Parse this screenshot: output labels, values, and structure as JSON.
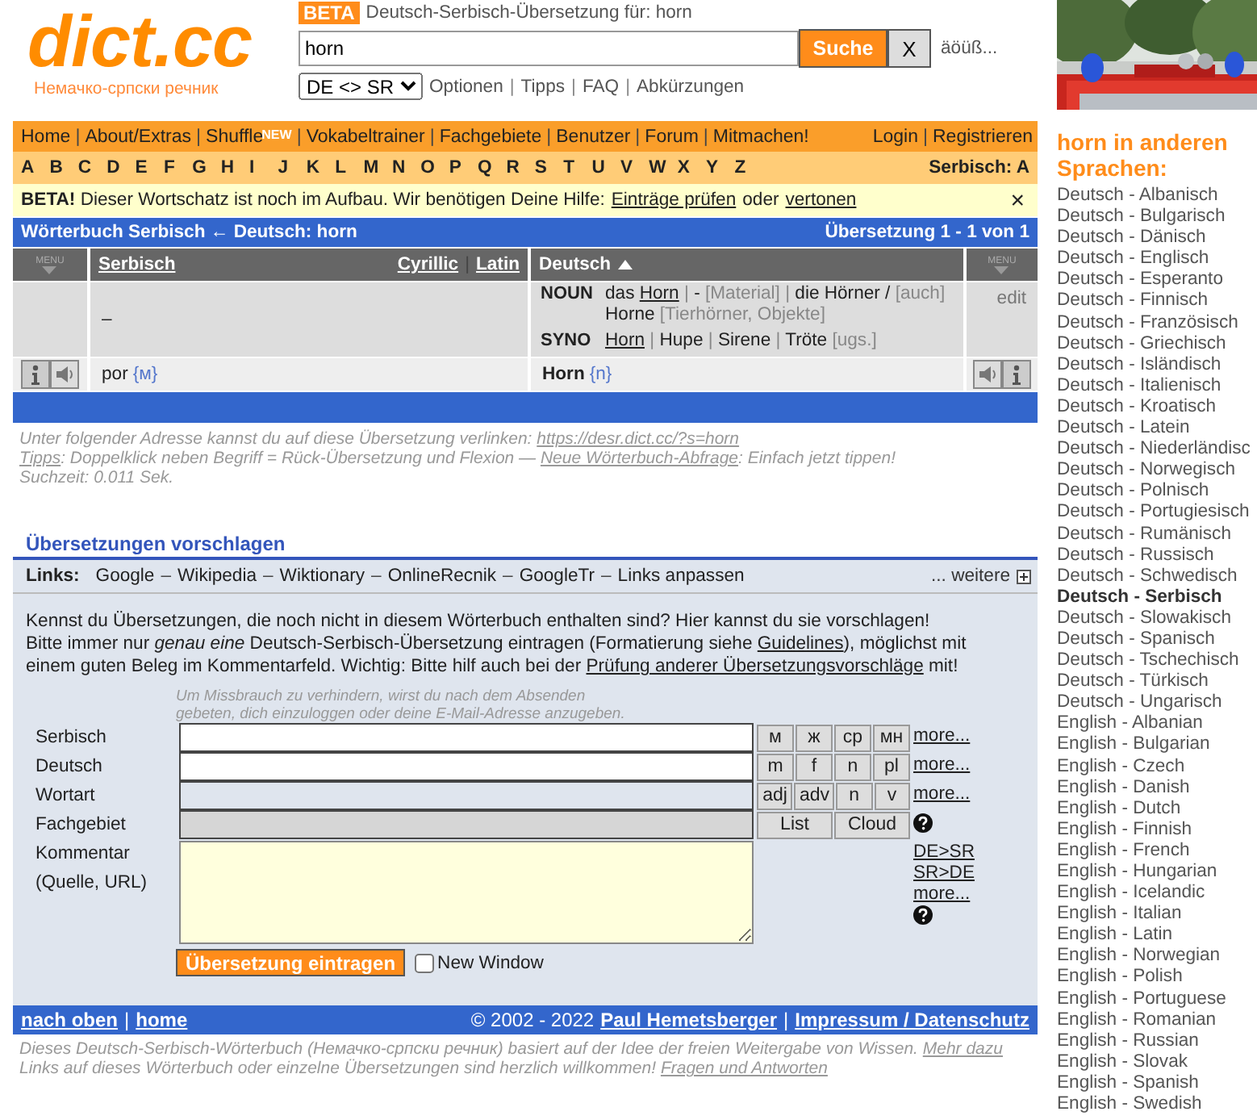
{
  "header": {
    "logo": "dict.cc",
    "subtitle": "Немачко-српски речник",
    "badge": "BETA",
    "heading": "Deutsch-Serbisch-Übersetzung für: horn",
    "query": "horn",
    "search_button": "Suche",
    "clear_button": "X",
    "special_chars": "äöüß...",
    "direction": "DE <> SR",
    "separator": "|",
    "links": [
      "Optionen",
      "Tipps",
      "FAQ",
      "Abkürzungen"
    ]
  },
  "nav": {
    "separator": "|",
    "items": [
      {
        "label": "Home"
      },
      {
        "label": "About/Extras"
      },
      {
        "label": "Shuffle",
        "badge": "NEW"
      },
      {
        "label": "Vokabeltrainer"
      },
      {
        "label": "Fachgebiete"
      },
      {
        "label": "Benutzer"
      },
      {
        "label": "Forum"
      },
      {
        "label": "Mitmachen!"
      }
    ],
    "right": [
      "Login",
      "Registrieren"
    ]
  },
  "letters": {
    "items": [
      "A",
      "B",
      "C",
      "D",
      "E",
      "F",
      "G",
      "H",
      "I",
      "J",
      "K",
      "L",
      "M",
      "N",
      "O",
      "P",
      "Q",
      "R",
      "S",
      "T",
      "U",
      "V",
      "W",
      "X",
      "Y",
      "Z"
    ],
    "current": "Serbisch: A"
  },
  "notice": {
    "text": "**BETA!** Dieser Wortschatz ist noch im Aufbau. Wir benötigen Deine Hilfe:",
    "link": "Einträge prüfen",
    "joiner": "oder",
    "link2": "vertonen",
    "close": "×"
  },
  "results": {
    "title": "Wörterbuch Serbisch ← Deutsch: horn",
    "count": "Übersetzung 1 - 1 von 1",
    "menu_labels": [
      "MENU",
      "MENU"
    ],
    "left_column": {
      "label": "Serbisch",
      "scripts": [
        "Cyrillic",
        "Latin"
      ],
      "separator": "|"
    },
    "right_column": {
      "label": "Deutsch",
      "sorted": true
    },
    "definition": {
      "left": "–",
      "action": "edit",
      "lines": [
        {
          "tag": "NOUN",
          "segments": [
            {
              "kind": "text",
              "text": "das "
            },
            {
              "kind": "link",
              "text": "Horn"
            },
            {
              "kind": "note",
              "text": " | "
            },
            {
              "kind": "text",
              "text": "- "
            },
            {
              "kind": "note",
              "text": "[Material] | "
            },
            {
              "kind": "text",
              "text": "die Hörner / "
            },
            {
              "kind": "note",
              "text": "[auch] "
            },
            {
              "kind": "text",
              "text": "Horne "
            },
            {
              "kind": "note",
              "text": "[Tierhörner, Objekte]"
            }
          ]
        },
        {
          "tag": "SYNO",
          "segments": [
            {
              "kind": "link",
              "text": "Horn"
            },
            {
              "kind": "note",
              "text": " | "
            },
            {
              "kind": "text",
              "text": "Hupe"
            },
            {
              "kind": "note",
              "text": " | "
            },
            {
              "kind": "text",
              "text": "Sirene"
            },
            {
              "kind": "note",
              "text": " | "
            },
            {
              "kind": "text",
              "text": "Tröte "
            },
            {
              "kind": "note",
              "text": "[ugs.]"
            }
          ]
        }
      ]
    },
    "entry": {
      "left": {
        "term": "por",
        "gender": "{м}"
      },
      "right": {
        "term": "Horn",
        "gender": "{n}"
      }
    }
  },
  "notes": [
    [
      {
        "kind": "text",
        "text": "Unter folgender Adresse kannst du auf diese Übersetzung verlinken: "
      },
      {
        "kind": "link",
        "text": "https://desr.dict.cc/?s=horn"
      }
    ],
    [
      {
        "kind": "link",
        "text": "Tipps"
      },
      {
        "kind": "text",
        "text": ": Doppelklick neben Begriff = Rück-Übersetzung und Flexion — "
      },
      {
        "kind": "link",
        "text": "Neue Wörterbuch-Abfrage"
      },
      {
        "kind": "text",
        "text": ": Einfach jetzt tippen!"
      }
    ],
    [
      {
        "kind": "text",
        "text": "Suchzeit: 0.011 Sek."
      }
    ]
  ],
  "suggest": {
    "heading": "Übersetzungen vorschlagen",
    "links_label": "Links:",
    "links": [
      "Google",
      "Wikipedia",
      "Wiktionary",
      "OnlineRecnik",
      "GoogleTr",
      "Links anpassen"
    ],
    "separator": "–",
    "more": "... weitere",
    "intro": [
      [
        {
          "kind": "text",
          "text": "Kennst du Übersetzungen, die noch nicht in diesem Wörterbuch enthalten sind? Hier kannst du sie vorschlagen!"
        }
      ],
      [
        {
          "kind": "text",
          "text": "Bitte immer nur *genau eine* Deutsch-Serbisch-Übersetzung eintragen (Formatierung siehe "
        },
        {
          "kind": "link",
          "text": "Guidelines"
        },
        {
          "kind": "text",
          "text": "), möglichst mit einem guten Beleg im Kommentarfeld. Wichtig: Bitte hilf auch bei der "
        },
        {
          "kind": "link",
          "text": "Prüfung anderer Übersetzungsvorschläge"
        },
        {
          "kind": "text",
          "text": " mit!"
        }
      ]
    ],
    "hint": "Um Missbrauch zu verhindern, wirst du nach dem Absenden gebeten, dich einzuloggen oder deine E-Mail-Adresse anzugeben.",
    "rows": [
      {
        "label": "Serbisch",
        "kind": "text",
        "buttons": [
          "м",
          "ж",
          "ср",
          "мн"
        ],
        "links": [
          "more..."
        ],
        "help": false
      },
      {
        "label": "Deutsch",
        "kind": "text",
        "buttons": [
          "m",
          "f",
          "n",
          "pl"
        ],
        "links": [
          "more..."
        ],
        "help": false
      },
      {
        "label": "Wortart",
        "kind": "readonly",
        "buttons": [
          "adj",
          "adv",
          "n",
          "v"
        ],
        "links": [
          "more..."
        ],
        "help": false
      },
      {
        "label": "Fachgebiet",
        "kind": "disabled",
        "buttons": [
          "List",
          "Cloud"
        ],
        "help": true
      },
      {
        "label": "Kommentar (Quelle, URL)",
        "kind": "textarea",
        "links": [
          "DE>SR",
          "SR>DE",
          "more..."
        ],
        "help": true
      }
    ],
    "submit": "Übersetzung eintragen",
    "new_window": {
      "label": "New Window",
      "checked": false
    }
  },
  "footer": {
    "left": [
      "nach oben",
      "home"
    ],
    "separator": "|",
    "copyright": "© 2002 - 2022",
    "right": [
      "Paul Hemetsberger",
      "Impressum / Datenschutz"
    ]
  },
  "bottom_notes": [
    [
      {
        "kind": "text",
        "text": "Dieses Deutsch-Serbisch-Wörterbuch (Немачко-српски речник) basiert auf der Idee der freien Weitergabe von Wissen. "
      },
      {
        "kind": "link",
        "text": "Mehr dazu"
      }
    ],
    [
      {
        "kind": "text",
        "text": "Links auf dieses Wörterbuch oder einzelne Übersetzungen sind herzlich willkommen! "
      },
      {
        "kind": "link",
        "text": "Fragen und Antworten"
      }
    ]
  ],
  "sidebar": {
    "heading": "horn in anderen Sprachen:",
    "languages": [
      {
        "label": "Deutsch - Albanisch",
        "selected": false
      },
      {
        "label": "Deutsch - Bulgarisch",
        "selected": false
      },
      {
        "label": "Deutsch - Dänisch",
        "selected": false
      },
      {
        "label": "Deutsch - Englisch",
        "selected": false
      },
      {
        "label": "Deutsch - Esperanto",
        "selected": false
      },
      {
        "label": "Deutsch - Finnisch",
        "selected": false
      },
      {
        "label": "Deutsch - Französisch",
        "selected": false
      },
      {
        "label": "Deutsch - Griechisch",
        "selected": false
      },
      {
        "label": "Deutsch - Isländisch",
        "selected": false
      },
      {
        "label": "Deutsch - Italienisch",
        "selected": false
      },
      {
        "label": "Deutsch - Kroatisch",
        "selected": false
      },
      {
        "label": "Deutsch - Latein",
        "selected": false
      },
      {
        "label": "Deutsch - Niederländisc",
        "selected": false
      },
      {
        "label": "Deutsch - Norwegisch",
        "selected": false
      },
      {
        "label": "Deutsch - Polnisch",
        "selected": false
      },
      {
        "label": "Deutsch - Portugiesisch",
        "selected": false
      },
      {
        "label": "Deutsch - Rumänisch",
        "selected": false
      },
      {
        "label": "Deutsch - Russisch",
        "selected": false
      },
      {
        "label": "Deutsch - Schwedisch",
        "selected": false
      },
      {
        "label": "Deutsch - Serbisch",
        "selected": true
      },
      {
        "label": "Deutsch - Slowakisch",
        "selected": false
      },
      {
        "label": "Deutsch - Spanisch",
        "selected": false
      },
      {
        "label": "Deutsch - Tschechisch",
        "selected": false
      },
      {
        "label": "Deutsch - Türkisch",
        "selected": false
      },
      {
        "label": "Deutsch - Ungarisch",
        "selected": false
      },
      {
        "label": "English - Albanian",
        "selected": false
      },
      {
        "label": "English - Bulgarian",
        "selected": false
      },
      {
        "label": "English - Czech",
        "selected": false
      },
      {
        "label": "English - Danish",
        "selected": false
      },
      {
        "label": "English - Dutch",
        "selected": false
      },
      {
        "label": "English - Finnish",
        "selected": false
      },
      {
        "label": "English - French",
        "selected": false
      },
      {
        "label": "English - Hungarian",
        "selected": false
      },
      {
        "label": "English - Icelandic",
        "selected": false
      },
      {
        "label": "English - Italian",
        "selected": false
      },
      {
        "label": "English - Latin",
        "selected": false
      },
      {
        "label": "English - Norwegian",
        "selected": false
      },
      {
        "label": "English - Polish",
        "selected": false
      },
      {
        "label": "English - Portuguese",
        "selected": false
      },
      {
        "label": "English - Romanian",
        "selected": false
      },
      {
        "label": "English - Russian",
        "selected": false
      },
      {
        "label": "English - Slovak",
        "selected": false
      },
      {
        "label": "English - Spanish",
        "selected": false
      },
      {
        "label": "English - Swedish",
        "selected": false
      }
    ]
  }
}
